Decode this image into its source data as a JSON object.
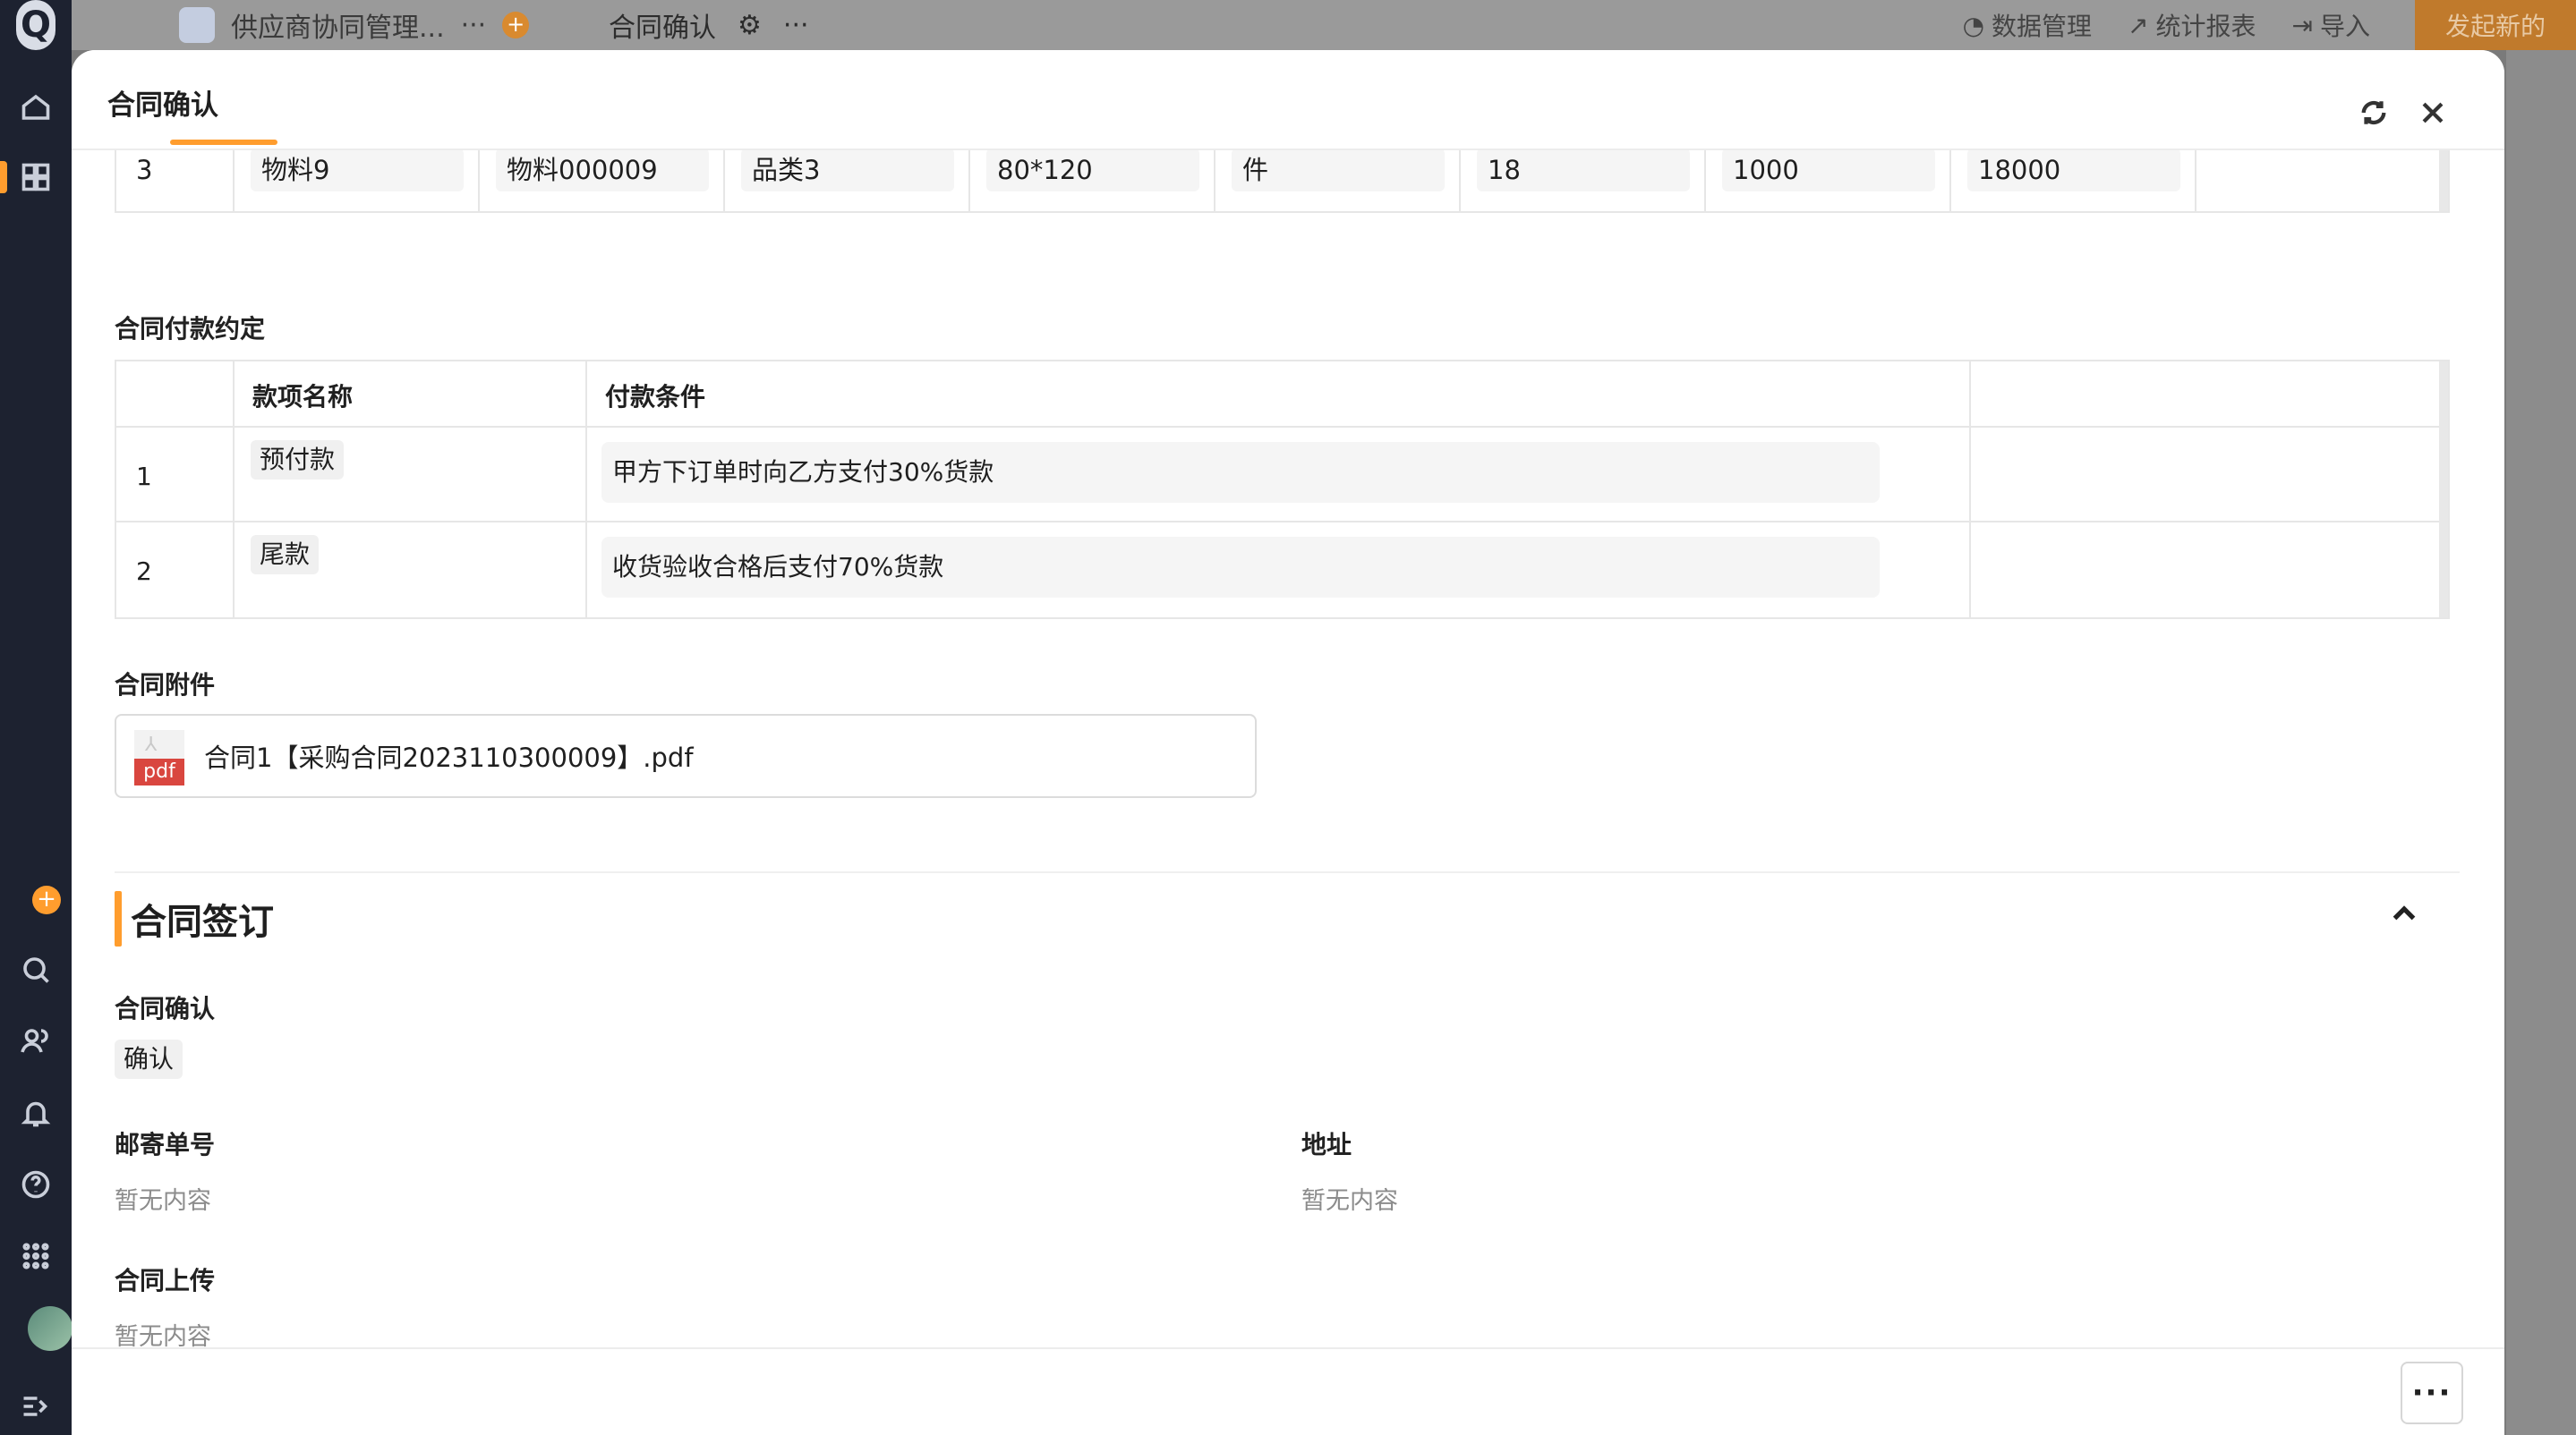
{
  "background": {
    "app_tab_label": "供应商协同管理...",
    "page_title": "合同确认",
    "toolbar": {
      "data_manage": "数据管理",
      "stat_report": "统计报表",
      "import": "导入",
      "launch": "发起新的"
    },
    "rail_logo": "Q"
  },
  "modal": {
    "title": "合同确认",
    "materials_row": {
      "index": "3",
      "material_name": "物料9",
      "material_code": "物料000009",
      "category": "品类3",
      "spec": "80*120",
      "unit": "件",
      "quantity": "18",
      "unit_price": "1000",
      "amount": "18000"
    },
    "payment": {
      "section_title": "合同付款约定",
      "columns": [
        "款项名称",
        "付款条件"
      ],
      "rows": [
        {
          "index": "1",
          "name": "预付款",
          "condition": "甲方下订单时向乙方支付30%货款"
        },
        {
          "index": "2",
          "name": "尾款",
          "condition": "收货验收合格后支付70%货款"
        }
      ]
    },
    "attachment": {
      "section_title": "合同附件",
      "file_name": "合同1【采购合同2023110300009】.pdf",
      "file_type": "pdf"
    },
    "signing": {
      "section_title": "合同签订",
      "confirm_label": "合同确认",
      "confirm_value": "确认",
      "tracking_label": "邮寄单号",
      "tracking_value": "暂无内容",
      "address_label": "地址",
      "address_value": "暂无内容",
      "upload_label": "合同上传",
      "upload_value": "暂无内容"
    },
    "footer": {
      "more_label": "···"
    }
  },
  "colors": {
    "accent": "#ff9d2e",
    "pdf_badge": "#d9463f",
    "rail_bg": "#1d2230"
  }
}
